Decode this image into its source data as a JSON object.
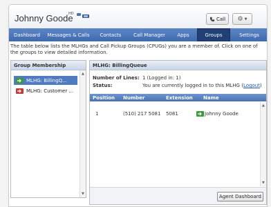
{
  "header": {
    "user_name": "Johnny Goode",
    "hd_label": "HD",
    "call_label": "Call"
  },
  "nav": {
    "tabs": [
      {
        "label": "Dashboard"
      },
      {
        "label": "Messages & Calls"
      },
      {
        "label": "Contacts"
      },
      {
        "label": "Call Manager"
      },
      {
        "label": "Apps"
      },
      {
        "label": "Groups"
      },
      {
        "label": "Settings"
      }
    ],
    "active": "Groups"
  },
  "intro": {
    "text": "The table below lists the MLHGs and Call Pickup Groups (CPUGs) you are a member of. Click on one of the groups to view detailed information."
  },
  "group_membership": {
    "title": "Group Membership",
    "items": [
      {
        "label": "MLHG: BillingQ...",
        "selected": true
      },
      {
        "label": "MLHG: Customer ...",
        "selected": false
      }
    ]
  },
  "detail": {
    "title": "MLHG: BillingQueue",
    "number_of_lines_label": "Number of Lines:",
    "number_of_lines_value": "1  (Logged in: 1)",
    "status_label": "Status:",
    "status_value": "You are currently logged in to this MLHG (",
    "logout_label": "Logout",
    "status_close": ")",
    "columns": [
      "Position",
      "Number",
      "Extension",
      "Name"
    ],
    "rows": [
      {
        "position": "1",
        "number": "(510) 217 5081",
        "extension": "5081",
        "name": "Johnny Goode"
      }
    ],
    "agent_dashboard_label": "Agent Dashboard"
  },
  "colors": {
    "nav_bg": "#4a74b6",
    "active_tab": "#1f3f75",
    "selected_item": "#4f7cc0",
    "link": "#2255aa"
  }
}
